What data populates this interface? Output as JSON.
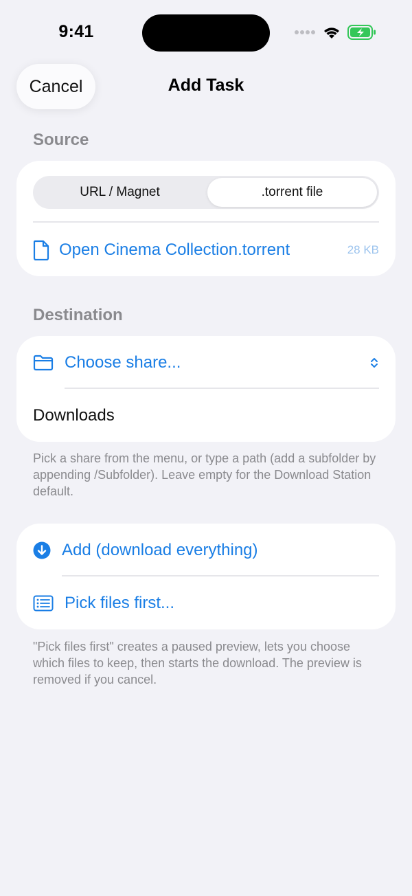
{
  "status_bar": {
    "time": "9:41",
    "icons": [
      "signal-icon",
      "wifi-icon",
      "battery-charging-icon"
    ]
  },
  "nav": {
    "cancel_label": "Cancel",
    "title": "Add Task"
  },
  "source": {
    "header": "Source",
    "segments": [
      {
        "label": "URL / Magnet",
        "selected": false
      },
      {
        "label": ".torrent file",
        "selected": true
      }
    ],
    "file_row": {
      "label": "Open Cinema Collection.torrent",
      "size": "28 KB",
      "icon": "document-icon"
    }
  },
  "destination": {
    "header": "Destination",
    "share_picker": {
      "label": "Choose share...",
      "icon": "folder-icon",
      "chevron": "chevron-up-down-icon"
    },
    "path_value": "Downloads",
    "footnote": "Pick a share from the menu, or type a path (add a subfolder by appending /Subfolder). Leave empty for the Download Station default."
  },
  "actions": {
    "add_label": "Add (download everything)",
    "add_icon": "arrow-down-circle-icon",
    "pick_label": "Pick files first...",
    "pick_icon": "list-icon",
    "footnote": "\"Pick files first\" creates a paused preview, lets you choose which files to keep, then starts the download. The preview is removed if you cancel."
  },
  "colors": {
    "accent": "#1a7ee5",
    "background": "#f2f2f7",
    "battery": "#34c759"
  }
}
